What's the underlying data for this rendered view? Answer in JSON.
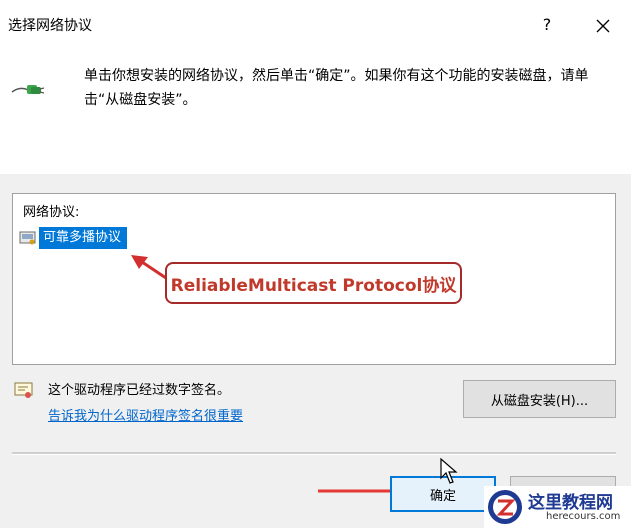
{
  "dialog": {
    "title": "选择网络协议",
    "help_label": "?",
    "instruction": "单击你想安装的网络协议，然后单击“确定”。如果你有这个功能的安装磁盘，请单击“从磁盘安装”。"
  },
  "protocol_list": {
    "header": "网络协议:",
    "items": [
      {
        "label": "可靠多播协议",
        "selected": true
      }
    ]
  },
  "annotation": {
    "text": "ReliableMulticast Protocol协议",
    "color": "#a52a2a"
  },
  "signature": {
    "status_text": "这个驱动程序已经过数字签名。",
    "link_text": "告诉我为什么驱动程序签名很重要"
  },
  "buttons": {
    "install_from_disk": "从磁盘安装(H)...",
    "ok": "确定",
    "cancel": ""
  },
  "watermark": {
    "title": "这里教程网",
    "url": "herecours.com"
  },
  "icons": {
    "network": "network-plug-icon",
    "protocol": "protocol-icon",
    "certificate": "certificate-icon",
    "close": "close-icon"
  },
  "colors": {
    "selection": "#0078d7",
    "link": "#0066cc",
    "annotation_arrow": "#d32f2f"
  }
}
